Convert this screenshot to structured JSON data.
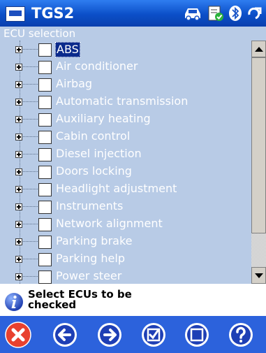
{
  "titlebar": {
    "app_icon": "app-window-icon",
    "title": "TGS2",
    "status_icons": [
      "vehicle-icon",
      "checklist-icon",
      "bluetooth-icon",
      "connection-arrow-icon"
    ]
  },
  "section": {
    "title": "ECU selection"
  },
  "tree": {
    "items": [
      {
        "label": "ABS",
        "checked": false,
        "selected": true
      },
      {
        "label": "Air conditioner",
        "checked": false,
        "selected": false
      },
      {
        "label": "Airbag",
        "checked": false,
        "selected": false
      },
      {
        "label": "Automatic transmission",
        "checked": false,
        "selected": false
      },
      {
        "label": "Auxiliary heating",
        "checked": false,
        "selected": false
      },
      {
        "label": "Cabin control",
        "checked": false,
        "selected": false
      },
      {
        "label": "Diesel injection",
        "checked": false,
        "selected": false
      },
      {
        "label": "Doors locking",
        "checked": false,
        "selected": false
      },
      {
        "label": "Headlight adjustment",
        "checked": false,
        "selected": false
      },
      {
        "label": "Instruments",
        "checked": false,
        "selected": false
      },
      {
        "label": "Network alignment",
        "checked": false,
        "selected": false
      },
      {
        "label": "Parking brake",
        "checked": false,
        "selected": false
      },
      {
        "label": "Parking help",
        "checked": false,
        "selected": false
      },
      {
        "label": "Power steer",
        "checked": false,
        "selected": false
      }
    ]
  },
  "info": {
    "icon": "info-icon",
    "line1": "Select ECUs to be",
    "line2": "checked"
  },
  "toolbar": {
    "buttons": [
      "close-icon",
      "back-arrow-icon",
      "forward-arrow-icon",
      "select-all-icon",
      "deselect-all-icon",
      "help-icon"
    ]
  },
  "colors": {
    "titlebar": "#0b4fc8",
    "list_background": "#b8cbe6",
    "toolbar": "#2c62dc",
    "selection": "#0a2a8c"
  }
}
